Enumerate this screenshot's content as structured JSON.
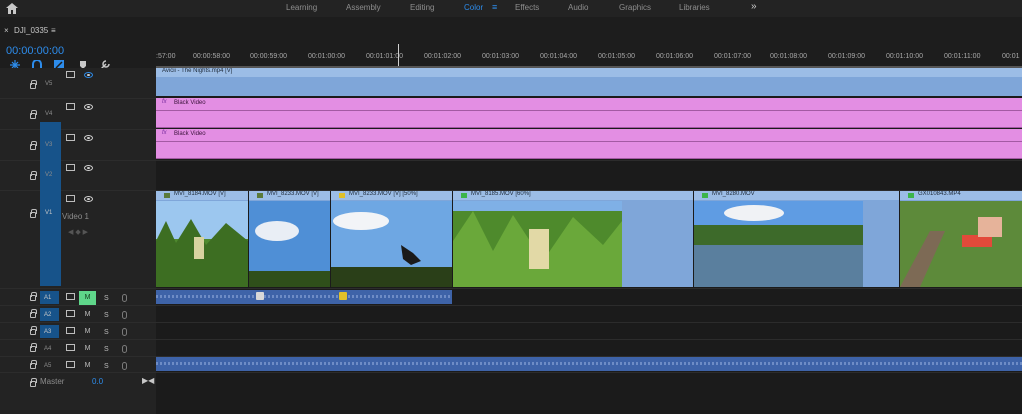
{
  "topbar": {
    "workspaces": [
      "Learning",
      "Assembly",
      "Editing",
      "Color",
      "Effects",
      "Audio",
      "Graphics",
      "Libraries"
    ],
    "active": "Color",
    "menu_glyph": "≡",
    "more_glyph": "»",
    "home_icon": "home-icon"
  },
  "sequence": {
    "close": "×",
    "name": "DJI_0335",
    "menu": "≡",
    "timecode": "00:00:00:00"
  },
  "ruler": {
    "ticks": [
      ":57:00",
      "00:00:58:00",
      "00:00:59:00",
      "00:01:00:00",
      "00:01:01:00",
      "00:01:02:00",
      "00:01:03:00",
      "00:01:04:00",
      "00:01:05:00",
      "00:01:06:00",
      "00:01:07:00",
      "00:01:08:00",
      "00:01:09:00",
      "00:01:10:00",
      "00:01:11:00",
      "00:01"
    ]
  },
  "tracks": {
    "video": [
      {
        "name": "V5"
      },
      {
        "name": "V4"
      },
      {
        "name": "V3"
      },
      {
        "name": "V2"
      },
      {
        "name": "V1",
        "label": "Video 1"
      }
    ],
    "audio": [
      {
        "name": "A1",
        "m": "M",
        "s": "S"
      },
      {
        "name": "A2",
        "m": "M",
        "s": "S"
      },
      {
        "name": "A3",
        "m": "M",
        "s": "S"
      },
      {
        "name": "A4",
        "m": "M",
        "s": "S"
      },
      {
        "name": "A5",
        "m": "M",
        "s": "S"
      }
    ],
    "master": {
      "label": "Master",
      "value": "0.0"
    }
  },
  "clips": {
    "v5": "Avicii - The Nights.mp4 [V]",
    "v4": "Black Video",
    "v3": "Black Video",
    "fx": "fx",
    "v1": [
      "MVI_8184.MOV [V]",
      "MVI_8233.MOV [V]",
      "MVI_8233.MOV [V] [50%]",
      "MVI_8185.MOV [60%]",
      "MVI_8280.MOV",
      "GX010843.MP4"
    ]
  },
  "colors": {
    "accent": "#2d8ceb",
    "video_clip": "#7fa6d9",
    "graphic_clip": "#e38ee3",
    "audio_clip": "#3e63a8",
    "mute_on": "#5fd68a"
  }
}
